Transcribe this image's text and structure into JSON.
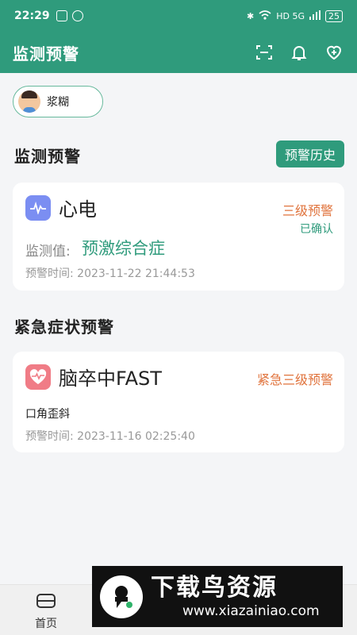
{
  "status_bar": {
    "time": "22:29",
    "battery": "25",
    "network": "HD 5G"
  },
  "header": {
    "title": "监测预警"
  },
  "user": {
    "name": "浆糊"
  },
  "monitoring": {
    "title": "监测预警",
    "history_button": "预警历史",
    "card": {
      "name": "心电",
      "level": "三级预警",
      "status": "已确认",
      "value_label": "监测值:",
      "value": "预激综合症",
      "time": "预警时间: 2023-11-22 21:44:53"
    }
  },
  "emergency": {
    "title": "紧急症状预警",
    "card": {
      "name": "脑卒中FAST",
      "level": "紧急三级预警",
      "symptom": "口角歪斜",
      "time": "预警时间: 2023-11-16 02:25:40"
    }
  },
  "tabbar": {
    "home": "首页"
  },
  "watermark": {
    "title": "下载鸟资源",
    "url": "www.xiazainiao.com"
  },
  "colors": {
    "primary": "#2f9b7c",
    "warning": "#e0733c",
    "ecg_icon": "#7b8ef2",
    "stroke_icon": "#f07c86"
  }
}
